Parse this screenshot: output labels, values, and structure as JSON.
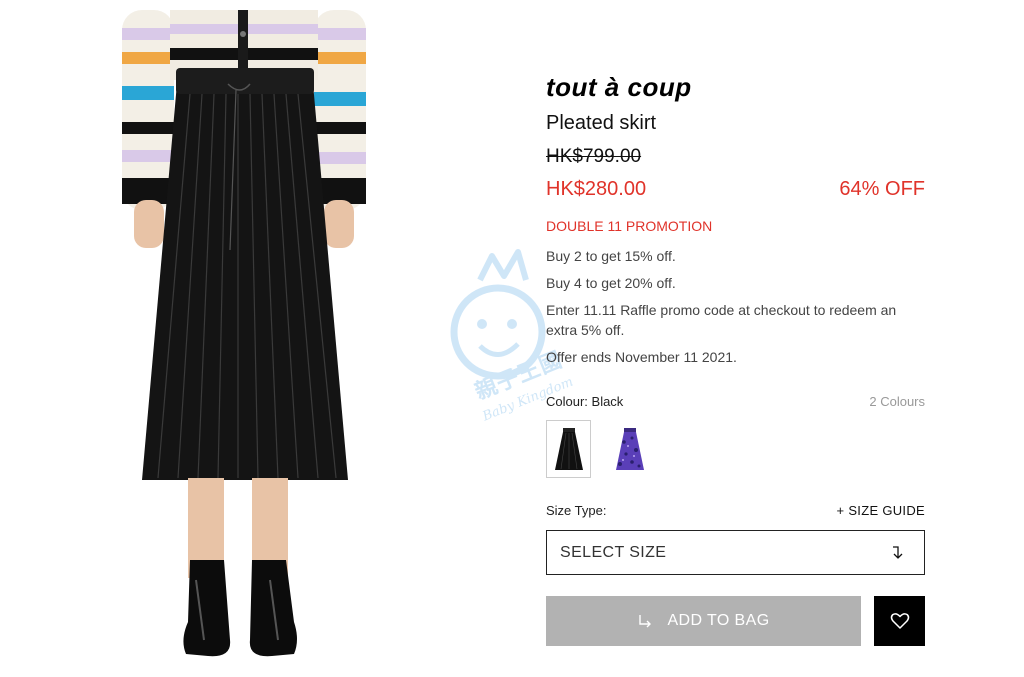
{
  "product": {
    "brand": "tout à coup",
    "name": "Pleated skirt",
    "original_price": "HK$799.00",
    "sale_price": "HK$280.00",
    "discount": "64% OFF",
    "image_icon": "pleated-skirt-model-photo"
  },
  "promotion": {
    "title": "DOUBLE 11 PROMOTION",
    "lines": [
      "Buy 2 to get 15% off.",
      "Buy 4 to get 20% off.",
      "Enter 11.11 Raffle promo code at checkout to redeem an extra 5% off.",
      "Offer ends November 11 2021."
    ]
  },
  "colour": {
    "label": "Colour: Black",
    "count": "2 Colours",
    "swatches": [
      {
        "name": "Black",
        "icon": "black-skirt-thumbnail",
        "color": "#111111",
        "selected": true
      },
      {
        "name": "Purple",
        "icon": "purple-print-skirt-thumbnail",
        "color": "#5a3fb8",
        "selected": false
      }
    ]
  },
  "size": {
    "type_label": "Size Type:",
    "guide_label": "+ SIZE GUIDE",
    "select_label": "SELECT SIZE",
    "arrow_icon": "arrow-down-icon"
  },
  "actions": {
    "add_to_bag": "ADD TO BAG",
    "add_icon": "arrow-return-icon",
    "wishlist_icon": "heart-icon"
  },
  "watermark": {
    "text_cn": "親子王國",
    "text_en": "Baby Kingdom",
    "icon": "baby-kingdom-logo"
  },
  "colors": {
    "sale_red": "#e0332a",
    "button_grey": "#b2b2b2",
    "wishlist_black": "#000000"
  }
}
